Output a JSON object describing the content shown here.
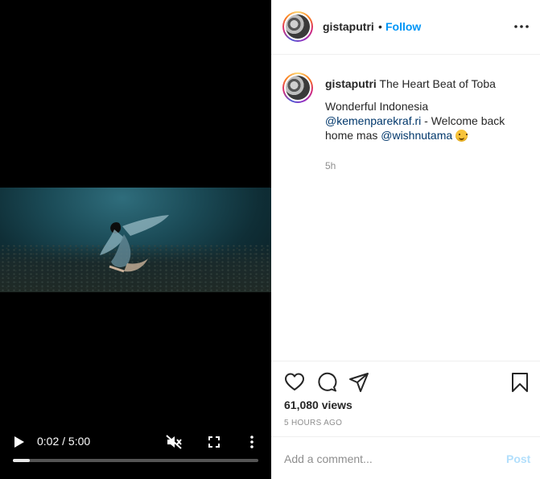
{
  "video": {
    "time_label": "0:02 / 5:00",
    "progress_fraction": 0.07
  },
  "header": {
    "username": "gistaputri",
    "dot": "•",
    "follow_label": "Follow"
  },
  "caption": {
    "username": "gistaputri",
    "title": "The Heart Beat of Toba",
    "line1": "Wonderful Indonesia",
    "mention1": "@kemenparekraf.ri",
    "middle_text": " - Welcome back home mas ",
    "mention2": "@wishnutama",
    "emoji": "smiling-face",
    "time": "5h"
  },
  "actions": {
    "icons": [
      "heart-icon",
      "comment-icon",
      "share-icon",
      "bookmark-icon"
    ],
    "views": "61,080 views",
    "time_ago": "5 HOURS AGO"
  },
  "comment": {
    "placeholder": "Add a comment...",
    "post_label": "Post"
  },
  "colors": {
    "follow": "#0095f6",
    "mention": "#00376b",
    "post_disabled": "#b2dffc",
    "muted": "#8e8e8e"
  }
}
